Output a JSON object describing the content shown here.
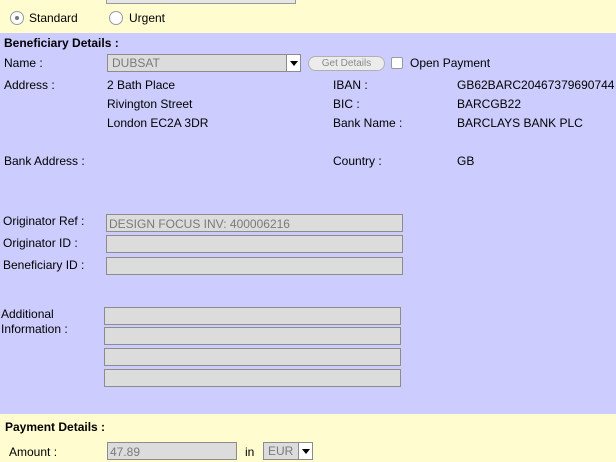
{
  "priority": {
    "options": [
      {
        "label": "Standard",
        "checked": true
      },
      {
        "label": "Urgent",
        "checked": false
      }
    ]
  },
  "beneficiary": {
    "section_title": "Beneficiary Details :",
    "name_label": "Name :",
    "name_value": "DUBSAT",
    "get_details_label": "Get Details",
    "open_payment_label": "Open Payment",
    "address_label": "Address :",
    "address_lines": [
      "2 Bath Place",
      "Rivington Street",
      "London EC2A 3DR"
    ],
    "iban_label": "IBAN :",
    "iban_value": "GB62BARC20467379690744",
    "bic_label": "BIC :",
    "bic_value": "BARCGB22",
    "bank_name_label": "Bank Name :",
    "bank_name_value": "BARCLAYS BANK PLC",
    "bank_address_label": "Bank Address :",
    "country_label": "Country :",
    "country_value": "GB",
    "originator_ref_label": "Originator Ref :",
    "originator_ref_value": "DESIGN FOCUS INV: 400006216",
    "originator_id_label": "Originator ID :",
    "originator_id_value": "",
    "beneficiary_id_label": "Beneficiary ID :",
    "beneficiary_id_value": "",
    "additional_info_label_1": "Additional",
    "additional_info_label_2": "Information :"
  },
  "payment": {
    "section_title": "Payment Details :",
    "amount_label": "Amount :",
    "amount_value": "47.89",
    "in_label": "in",
    "currency_value": "EUR"
  }
}
